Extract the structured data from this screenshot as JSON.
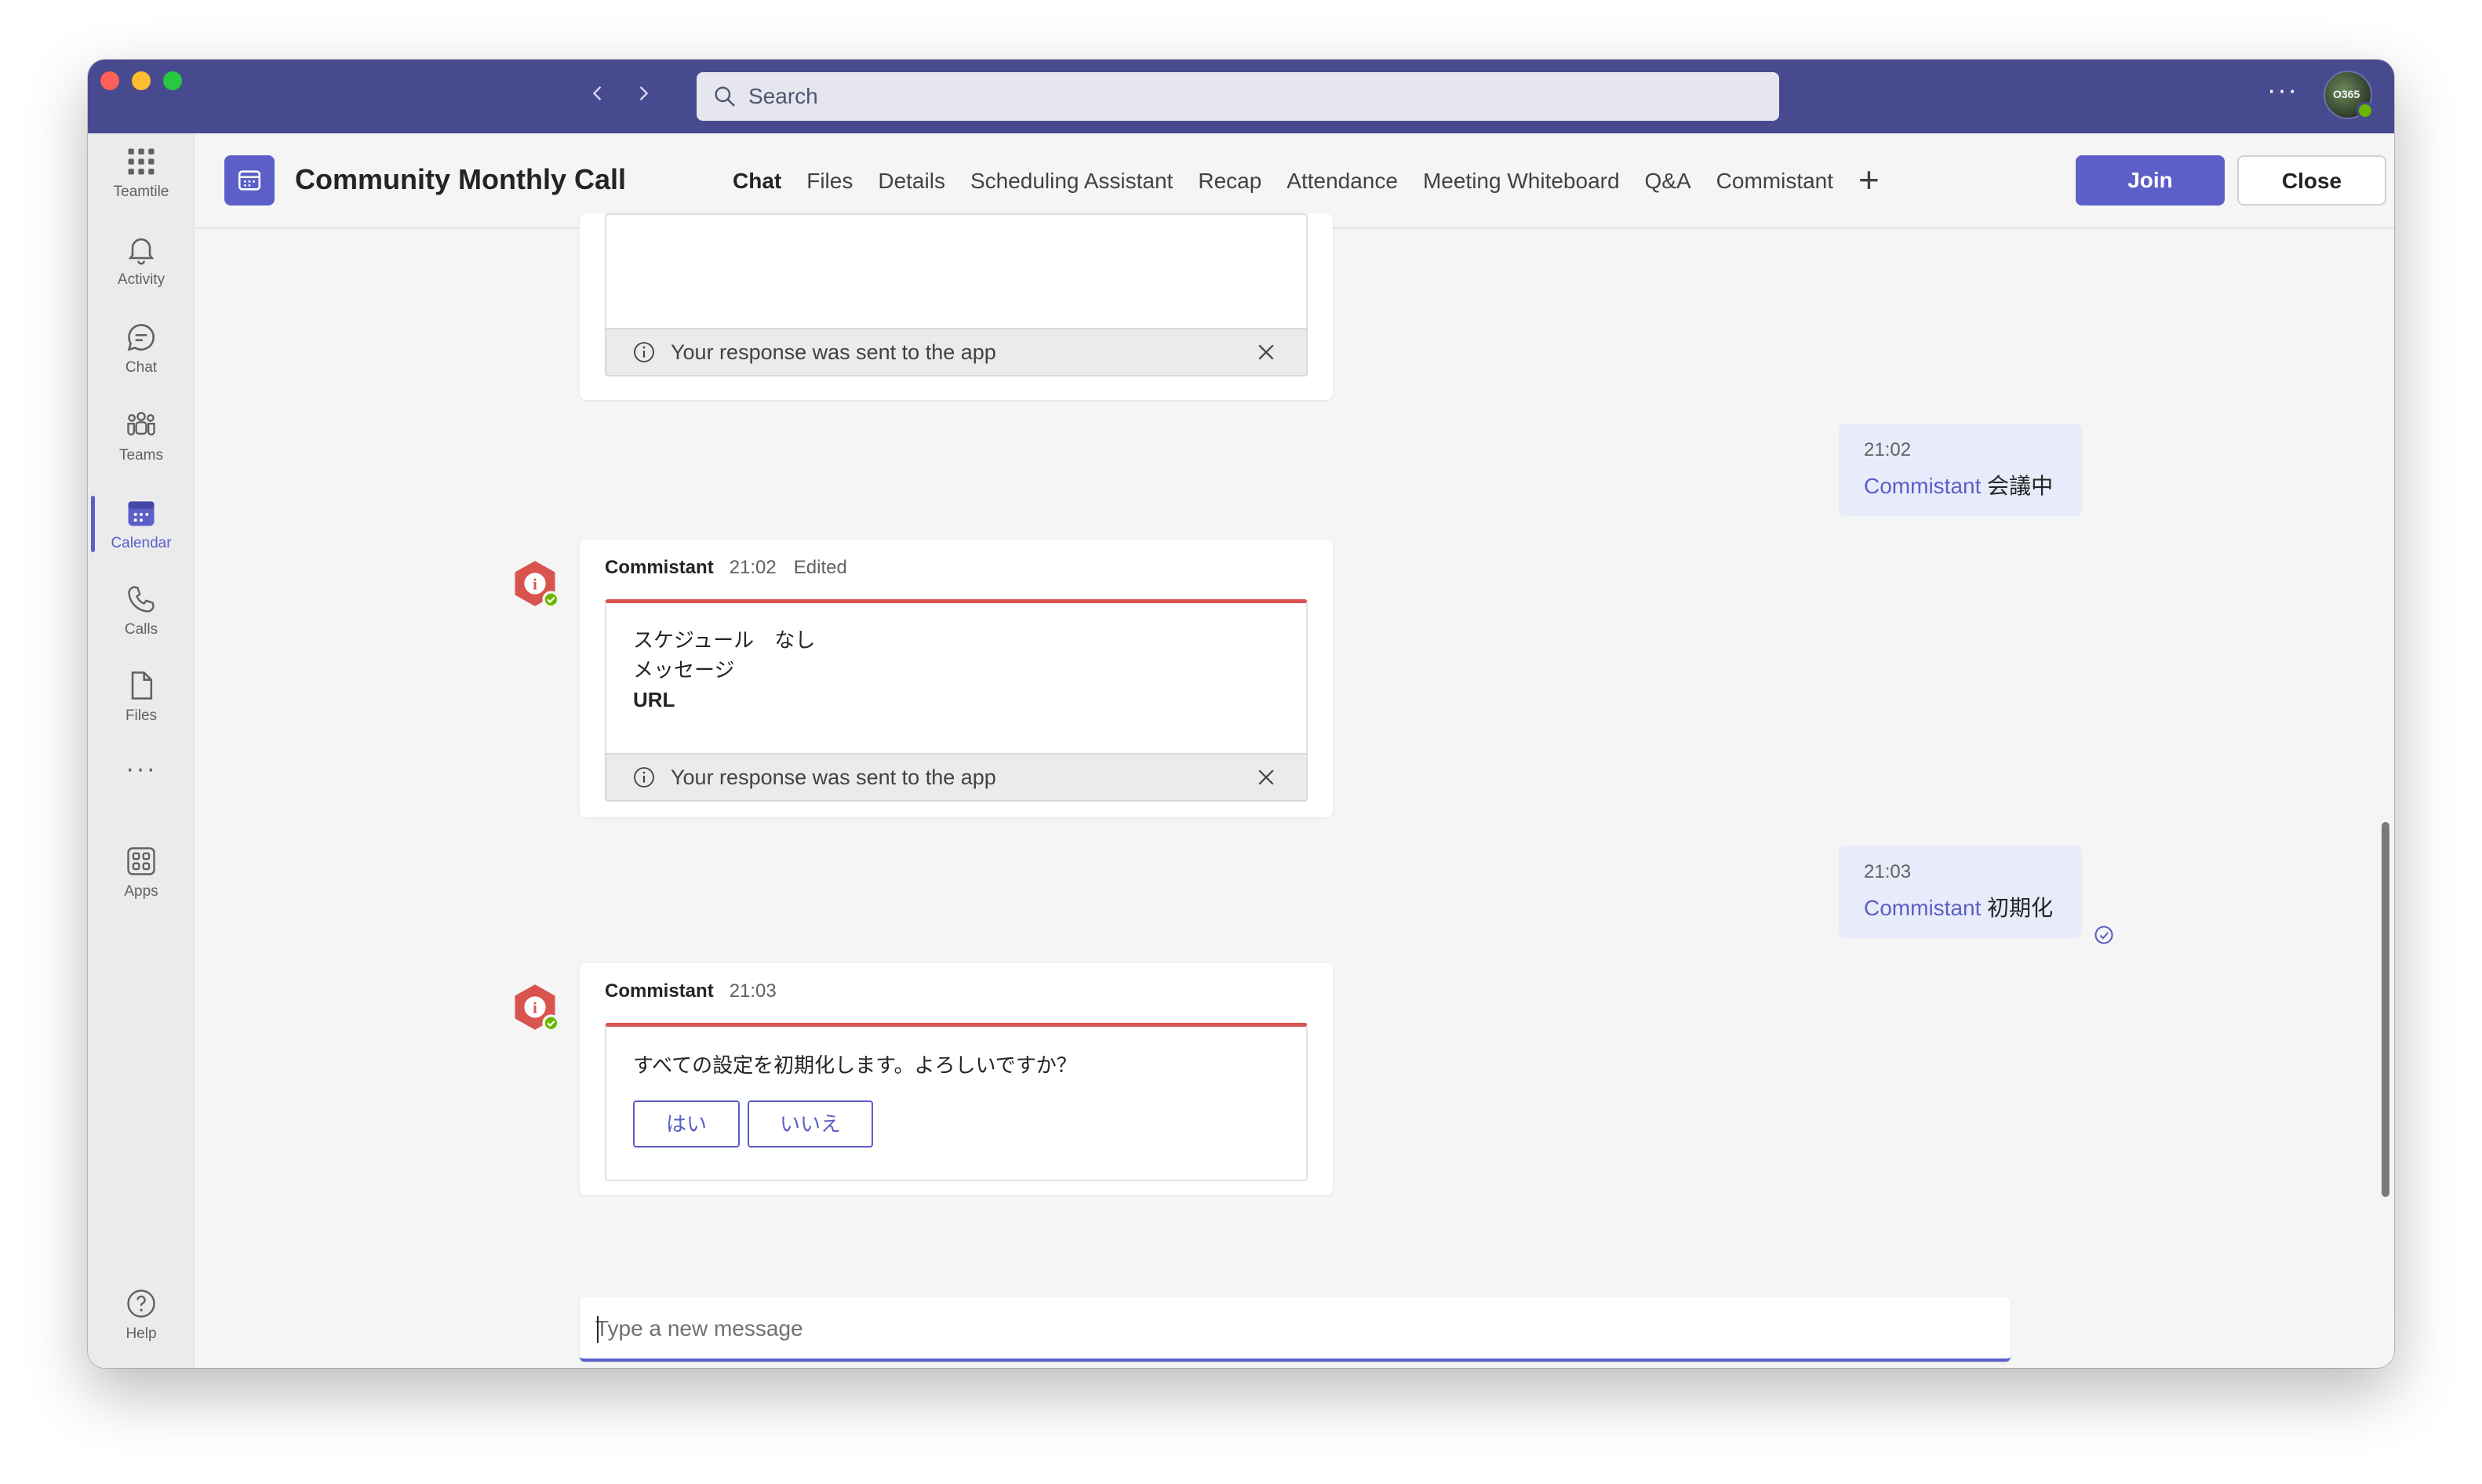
{
  "window": {
    "search_placeholder": "Search",
    "more_label": "···",
    "avatar_text": "O365"
  },
  "rail": {
    "items": [
      {
        "label": "Teamtile",
        "icon": "waffle-icon"
      },
      {
        "label": "Activity",
        "icon": "bell-icon"
      },
      {
        "label": "Chat",
        "icon": "chat-icon"
      },
      {
        "label": "Teams",
        "icon": "teams-icon"
      },
      {
        "label": "Calendar",
        "icon": "calendar-icon",
        "active": true
      },
      {
        "label": "Calls",
        "icon": "phone-icon"
      },
      {
        "label": "Files",
        "icon": "file-icon"
      },
      {
        "label": "···",
        "icon": "more-icon"
      },
      {
        "label": "Apps",
        "icon": "apps-icon"
      },
      {
        "label": "Help",
        "icon": "help-icon"
      }
    ]
  },
  "header": {
    "title": "Community Monthly Call",
    "tabs": [
      "Chat",
      "Files",
      "Details",
      "Scheduling Assistant",
      "Recap",
      "Attendance",
      "Meeting Whiteboard",
      "Q&A",
      "Commistant"
    ],
    "add_tab": "+",
    "join_label": "Join",
    "close_label": "Close"
  },
  "messages": {
    "first_card_footer": "Your response was sent to the app",
    "me1": {
      "time": "21:02",
      "mention": "Commistant",
      "text": " 会議中"
    },
    "bot1": {
      "sender": "Commistant",
      "time": "21:02",
      "edited": "Edited",
      "rows": [
        {
          "label": "スケジュール",
          "value": "なし"
        },
        {
          "label": "メッセージ",
          "value": ""
        },
        {
          "label": "URL",
          "value": ""
        }
      ],
      "footer": "Your response was sent to the app"
    },
    "me2": {
      "time": "21:03",
      "mention": "Commistant",
      "text": " 初期化"
    },
    "bot2": {
      "sender": "Commistant",
      "time": "21:03",
      "prompt": "すべての設定を初期化します。よろしいですか？",
      "yes_label": "はい",
      "no_label": "いいえ"
    }
  },
  "compose": {
    "placeholder": "Type a new message"
  },
  "colors": {
    "titlebar": "#474a8f",
    "brand": "#5b5fc7",
    "bot_accent": "#d9534f",
    "my_bubble": "#e8ebfa"
  }
}
